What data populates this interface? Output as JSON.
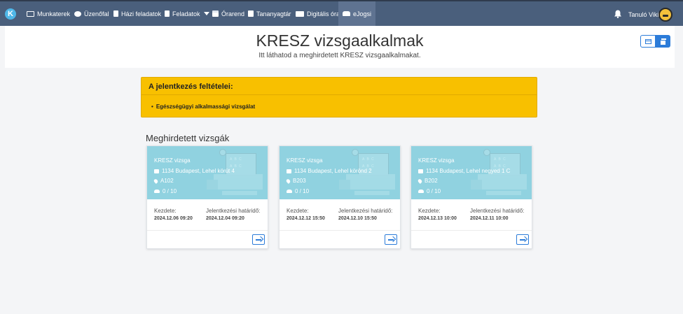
{
  "nav": {
    "items": [
      {
        "label": "Munkaterek",
        "icon": "monitor-icon"
      },
      {
        "label": "Üzenőfal",
        "icon": "chat-bubble-icon"
      },
      {
        "label": "Házi feladatok",
        "icon": "document-icon"
      },
      {
        "label": "Feladatok",
        "icon": "clipboard-icon"
      },
      {
        "label": "Órarend",
        "icon": "calendar-icon"
      },
      {
        "label": "Tananyagtár",
        "icon": "book-icon"
      },
      {
        "label": "Digitális óra",
        "icon": "video-camera-icon"
      },
      {
        "label": "eJogsi",
        "icon": "car-icon"
      }
    ],
    "user": "Tanuló Viki"
  },
  "header": {
    "title": "KRESZ vizsgaalkalmak",
    "subtitle": "Itt láthatod a meghirdetett KRESZ vizsgaalkalmakat."
  },
  "requirements": {
    "title": "A jelentkezés feltételei:",
    "items": [
      "Egészségügyi alkalmassági vizsgálat"
    ]
  },
  "exams": {
    "section_title": "Meghirdetett vizsgák",
    "start_label": "Kezdete:",
    "deadline_label": "Jelentkezési határidő:",
    "cards": [
      {
        "title": "KRESZ vizsga",
        "address": "1134 Budapest, Lehel körút 4",
        "room": "A102",
        "count": "0 / 10",
        "start": "2024.12.06 09:20",
        "deadline": "2024.12.04 09:20"
      },
      {
        "title": "KRESZ vizsga",
        "address": "1134 Budapest, Lehel körönd 2",
        "room": "B203",
        "count": "0 / 10",
        "start": "2024.12.12 15:50",
        "deadline": "2024.12.10 15:50"
      },
      {
        "title": "KRESZ vizsga",
        "address": "1134 Budapest, Lehel negyed 1 C",
        "room": "B202",
        "count": "0 / 10",
        "start": "2024.12.13 10:00",
        "deadline": "2024.12.11 10:00"
      }
    ]
  },
  "colors": {
    "nav_bg": "#4a5f7c",
    "accent": "#2c7cd9",
    "warning": "#f8c000",
    "card_top": "#90d2e0"
  }
}
